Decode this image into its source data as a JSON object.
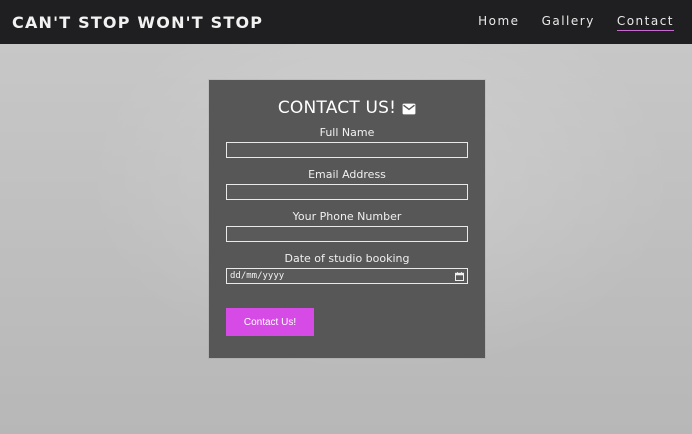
{
  "nav": {
    "brand": "CAN'T STOP WON'T STOP",
    "links": [
      "Home",
      "Gallery",
      "Contact"
    ],
    "active_color": "#c56bd0"
  },
  "form": {
    "title": "CONTACT US!",
    "fields": [
      {
        "label": "Full Name",
        "value": ""
      },
      {
        "label": "Email Address",
        "value": ""
      },
      {
        "label": "Your Phone Number",
        "value": ""
      },
      {
        "label": "Date of studio booking",
        "value": "dd/mm/yyyy"
      }
    ],
    "submit_label": "Contact Us!",
    "submit_color": "#d64be6"
  },
  "icons": {
    "title_icon": "mail-icon",
    "date_picker": "calendar-icon"
  }
}
